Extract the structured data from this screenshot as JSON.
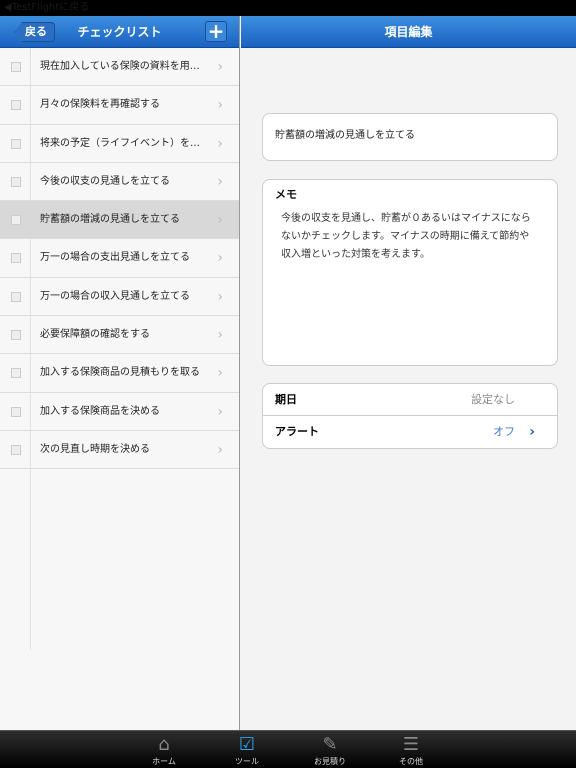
{
  "status": {
    "back_text": "◀TestFlightに戻る"
  },
  "left": {
    "back": "戻る",
    "title": "チェックリスト",
    "add": "+",
    "items": [
      {
        "label": "現在加入している保険の資料を用意する",
        "selected": false
      },
      {
        "label": "月々の保険料を再確認する",
        "selected": false
      },
      {
        "label": "将来の予定（ライフイベント）を確認...",
        "selected": false
      },
      {
        "label": "今後の収支の見通しを立てる",
        "selected": false
      },
      {
        "label": "貯蓄額の増減の見通しを立てる",
        "selected": true
      },
      {
        "label": "万一の場合の支出見通しを立てる",
        "selected": false
      },
      {
        "label": "万一の場合の収入見通しを立てる",
        "selected": false
      },
      {
        "label": "必要保障額の確認をする",
        "selected": false
      },
      {
        "label": "加入する保険商品の見積もりを取る",
        "selected": false
      },
      {
        "label": "加入する保険商品を決める",
        "selected": false
      },
      {
        "label": "次の見直し時期を決める",
        "selected": false
      }
    ]
  },
  "right": {
    "title": "項目編集",
    "item_title": "貯蓄額の増減の見通しを立てる",
    "memo_label": "メモ",
    "memo": "今後の収支を見通し、貯蓄が０あるいはマイナスにならないかチェックします。マイナスの時期に備えて節約や収入増といった対策を考えます。",
    "due_label": "期日",
    "due_value": "設定なし",
    "alert_label": "アラート",
    "alert_value": "オフ"
  },
  "tabs": [
    {
      "label": "ホーム",
      "icon": "home-icon"
    },
    {
      "label": "ツール",
      "icon": "checkbox-icon",
      "active": true
    },
    {
      "label": "お見積り",
      "icon": "estimate-icon"
    },
    {
      "label": "その他",
      "icon": "list-icon"
    }
  ],
  "colors": {
    "accent": "#1a62c0",
    "link": "#3a7be0"
  }
}
